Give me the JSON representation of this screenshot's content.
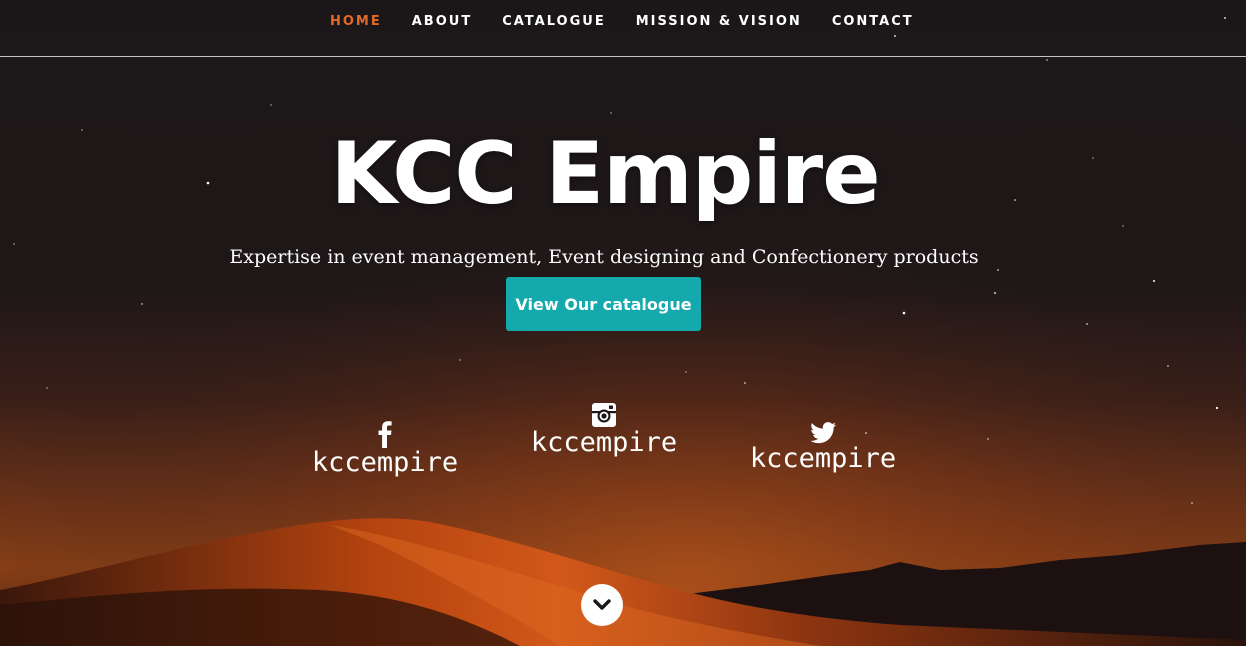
{
  "nav": {
    "items": [
      {
        "label": "HOME",
        "active": true
      },
      {
        "label": "ABOUT",
        "active": false
      },
      {
        "label": "CATALOGUE",
        "active": false
      },
      {
        "label": "MISSION & VISION",
        "active": false
      },
      {
        "label": "CONTACT",
        "active": false
      }
    ],
    "active_color": "#e06a2a"
  },
  "hero": {
    "title": "KCC Empire",
    "subtitle": "Expertise in event management, Event designing and Confectionery products",
    "cta_label": "View Our catalogue",
    "cta_color": "#13a9ad",
    "background": "night desert dunes with starry sky"
  },
  "social": [
    {
      "network": "facebook",
      "icon": "facebook-icon",
      "handle": "kccempire"
    },
    {
      "network": "instagram",
      "icon": "instagram-icon",
      "handle": "kccempire"
    },
    {
      "network": "twitter",
      "icon": "twitter-icon",
      "handle": "kccempire"
    }
  ],
  "scroll_down": {
    "icon": "chevron-down-icon"
  }
}
